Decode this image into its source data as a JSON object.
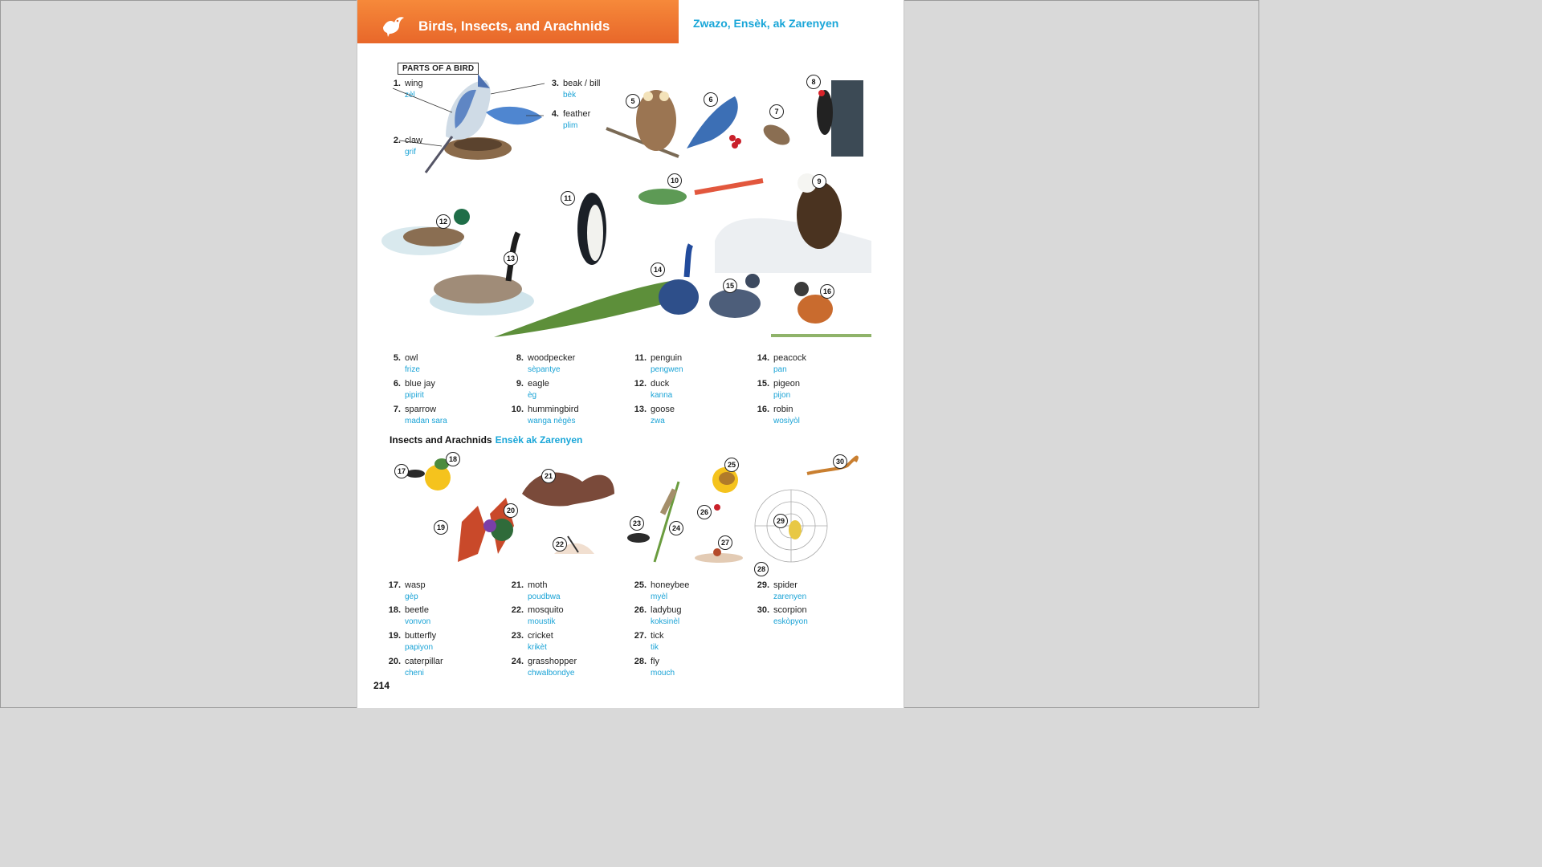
{
  "header": {
    "title": "Birds, Insects, and Arachnids",
    "subtitle": "Zwazo, Ensèk, ak Zarenyen"
  },
  "parts_label": "PARTS OF A BIRD",
  "parts": [
    {
      "num": "1.",
      "en": "wing",
      "ht": "zèl"
    },
    {
      "num": "2.",
      "en": "claw",
      "ht": "grif"
    },
    {
      "num": "3.",
      "en": "beak / bill",
      "ht": "bèk"
    },
    {
      "num": "4.",
      "en": "feather",
      "ht": "plim"
    }
  ],
  "birds": [
    {
      "num": "5.",
      "en": "owl",
      "ht": "frize"
    },
    {
      "num": "6.",
      "en": "blue jay",
      "ht": "pipirit"
    },
    {
      "num": "7.",
      "en": "sparrow",
      "ht": "madan sara"
    },
    {
      "num": "8.",
      "en": "woodpecker",
      "ht": "sèpantye"
    },
    {
      "num": "9.",
      "en": "eagle",
      "ht": "èg"
    },
    {
      "num": "10.",
      "en": "hummingbird",
      "ht": "wanga nègès"
    },
    {
      "num": "11.",
      "en": "penguin",
      "ht": "pengwen"
    },
    {
      "num": "12.",
      "en": "duck",
      "ht": "kanna"
    },
    {
      "num": "13.",
      "en": "goose",
      "ht": "zwa"
    },
    {
      "num": "14.",
      "en": "peacock",
      "ht": "pan"
    },
    {
      "num": "15.",
      "en": "pigeon",
      "ht": "pijon"
    },
    {
      "num": "16.",
      "en": "robin",
      "ht": "wosiyòl"
    }
  ],
  "insects_heading": {
    "en": "Insects and Arachnids",
    "ht": "Ensèk ak Zarenyen"
  },
  "insects": [
    {
      "num": "17.",
      "en": "wasp",
      "ht": "gèp"
    },
    {
      "num": "18.",
      "en": "beetle",
      "ht": "vonvon"
    },
    {
      "num": "19.",
      "en": "butterfly",
      "ht": "papiyon"
    },
    {
      "num": "20.",
      "en": "caterpillar",
      "ht": "cheni"
    },
    {
      "num": "21.",
      "en": "moth",
      "ht": "poudbwa"
    },
    {
      "num": "22.",
      "en": "mosquito",
      "ht": "moustik"
    },
    {
      "num": "23.",
      "en": "cricket",
      "ht": "krikèt"
    },
    {
      "num": "24.",
      "en": "grasshopper",
      "ht": "chwalbondye"
    },
    {
      "num": "25.",
      "en": "honeybee",
      "ht": "myèl"
    },
    {
      "num": "26.",
      "en": "ladybug",
      "ht": "koksinèl"
    },
    {
      "num": "27.",
      "en": "tick",
      "ht": "tik"
    },
    {
      "num": "28.",
      "en": "fly",
      "ht": "mouch"
    },
    {
      "num": "29.",
      "en": "spider",
      "ht": "zarenyen"
    },
    {
      "num": "30.",
      "en": "scorpion",
      "ht": "eskòpyon"
    }
  ],
  "callouts": [
    "5",
    "6",
    "7",
    "8",
    "9",
    "10",
    "11",
    "12",
    "13",
    "14",
    "15",
    "16",
    "17",
    "18",
    "19",
    "20",
    "21",
    "22",
    "23",
    "24",
    "25",
    "26",
    "27",
    "28",
    "29",
    "30"
  ],
  "page_number": "214"
}
